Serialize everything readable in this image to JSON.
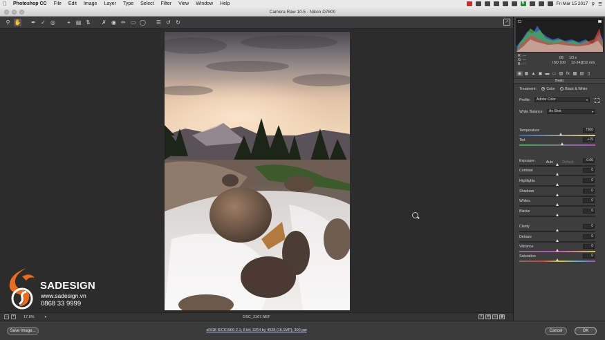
{
  "menubar": {
    "app_name": "Photoshop CC",
    "items": [
      "File",
      "Edit",
      "Image",
      "Layer",
      "Type",
      "Select",
      "Filter",
      "View",
      "Window",
      "Help"
    ],
    "clock": "Fri Mar 15  2017"
  },
  "window": {
    "title": "Camera Raw 10.5  -  Nikon D7800"
  },
  "toolbar": {
    "tools": [
      "zoom-icon",
      "hand-icon",
      "white-balance-icon",
      "color-sampler-icon",
      "target-adjust-icon",
      "crop-icon",
      "straighten-icon",
      "transform-icon",
      "spot-removal-icon",
      "red-eye-icon",
      "adjustment-brush-icon",
      "graduated-filter-icon",
      "radial-filter-icon",
      "preferences-icon",
      "rotate-left-icon",
      "rotate-right-icon"
    ]
  },
  "histogram": {
    "r_label": "R:",
    "g_label": "G:",
    "b_label": "B:",
    "r_value": "---",
    "g_value": "---",
    "b_value": "---",
    "aperture": "f/8",
    "shutter": "1/3 s",
    "iso": "ISO 100",
    "lens": "12-24@12 mm"
  },
  "panel": {
    "section_title": "Basic",
    "treatment_label": "Treatment:",
    "treatment_color": "Color",
    "treatment_bw": "Black & White",
    "treatment_selected": "Color",
    "profile_label": "Profile:",
    "profile_value": "Adobe Color",
    "wb_label": "White Balance:",
    "wb_value": "As Shot",
    "auto_label": "Auto",
    "default_label": "Default",
    "sliders": [
      {
        "label": "Temperature",
        "value": "7500",
        "position": 0.55
      },
      {
        "label": "Tint",
        "value": "+15",
        "position": 0.57
      },
      {
        "label": "Exposure",
        "value": "0.00",
        "position": 0.5
      },
      {
        "label": "Contrast",
        "value": "0",
        "position": 0.5
      },
      {
        "label": "Highlights",
        "value": "0",
        "position": 0.5
      },
      {
        "label": "Shadows",
        "value": "0",
        "position": 0.5
      },
      {
        "label": "Whites",
        "value": "0",
        "position": 0.5
      },
      {
        "label": "Blacks",
        "value": "0",
        "position": 0.5
      },
      {
        "label": "Clarity",
        "value": "0",
        "position": 0.5
      },
      {
        "label": "Dehaze",
        "value": "0",
        "position": 0.5
      },
      {
        "label": "Vibrance",
        "value": "0",
        "position": 0.5
      },
      {
        "label": "Saturation",
        "value": "0",
        "position": 0.5
      }
    ]
  },
  "statusbar": {
    "zoom": "17.8%",
    "filename": "DSC_2167.NEF"
  },
  "bottom": {
    "save_label": "Save Image...",
    "workflow_text": "sRGB IEC61966-2.1; 8 bit; 3264 by 4928 (16.1MP); 300 ppi",
    "cancel_label": "Cancel",
    "ok_label": "OK"
  },
  "watermark": {
    "brand": "SADESIGN",
    "url": "www.sadesign.vn",
    "phone": "0868 33 9999"
  }
}
